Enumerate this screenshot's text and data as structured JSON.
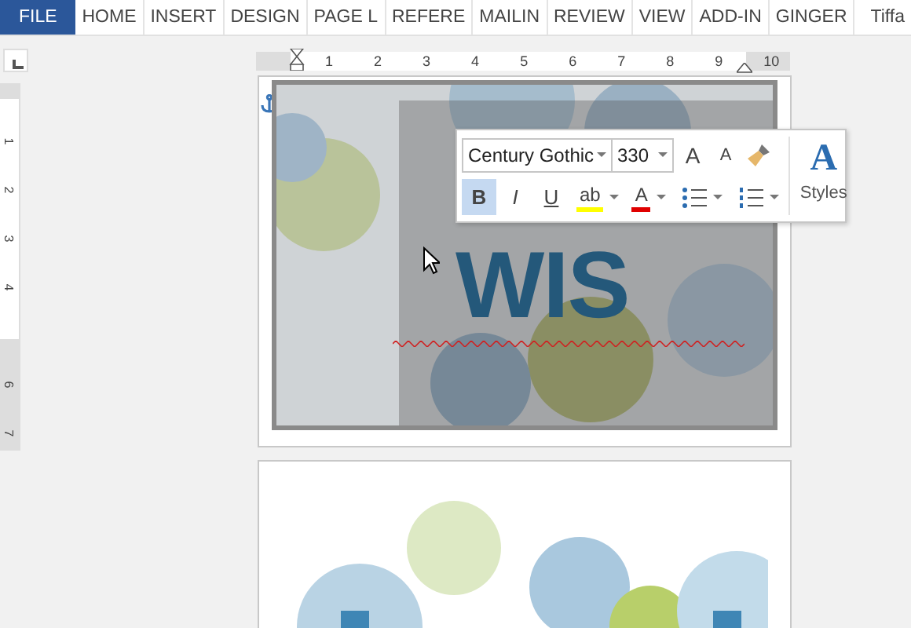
{
  "ribbon": {
    "tabs": [
      {
        "label": "FILE",
        "kind": "file",
        "selected": false
      },
      {
        "label": "HOME",
        "kind": "tab",
        "selected": false
      },
      {
        "label": "INSERT",
        "kind": "tab",
        "selected": false
      },
      {
        "label": "DESIGN",
        "kind": "tab",
        "selected": false
      },
      {
        "label": "PAGE L",
        "kind": "tab",
        "selected": false
      },
      {
        "label": "REFERE",
        "kind": "tab",
        "selected": false
      },
      {
        "label": "MAILIN",
        "kind": "tab",
        "selected": false
      },
      {
        "label": "REVIEW",
        "kind": "tab",
        "selected": false
      },
      {
        "label": "VIEW",
        "kind": "tab",
        "selected": false
      },
      {
        "label": "ADD-IN",
        "kind": "tab",
        "selected": false
      },
      {
        "label": "GINGER",
        "kind": "tab",
        "selected": false
      },
      {
        "label": "Tiffa",
        "kind": "user",
        "selected": false
      }
    ]
  },
  "horizontal_ruler": {
    "numbers": [
      "1",
      "2",
      "3",
      "4",
      "5",
      "6",
      "7",
      "8",
      "9",
      "10"
    ]
  },
  "vertical_ruler": {
    "numbers": [
      "1",
      "2",
      "3",
      "4",
      "6",
      "7"
    ]
  },
  "document": {
    "heading_text": "WIS",
    "spelling_error": true
  },
  "mini_toolbar": {
    "font": "Century Gothic",
    "size": "330",
    "grow_glyph": "A",
    "shrink_glyph": "A",
    "styles_glyph": "A",
    "styles_label": "Styles",
    "format_buttons": [
      {
        "label": "B",
        "kind": "bold",
        "selected": true
      },
      {
        "label": "I",
        "kind": "italic",
        "selected": false
      },
      {
        "label": "U",
        "kind": "underline",
        "selected": false
      }
    ],
    "highlight_glyph": "ab",
    "font_color_glyph": "A"
  }
}
